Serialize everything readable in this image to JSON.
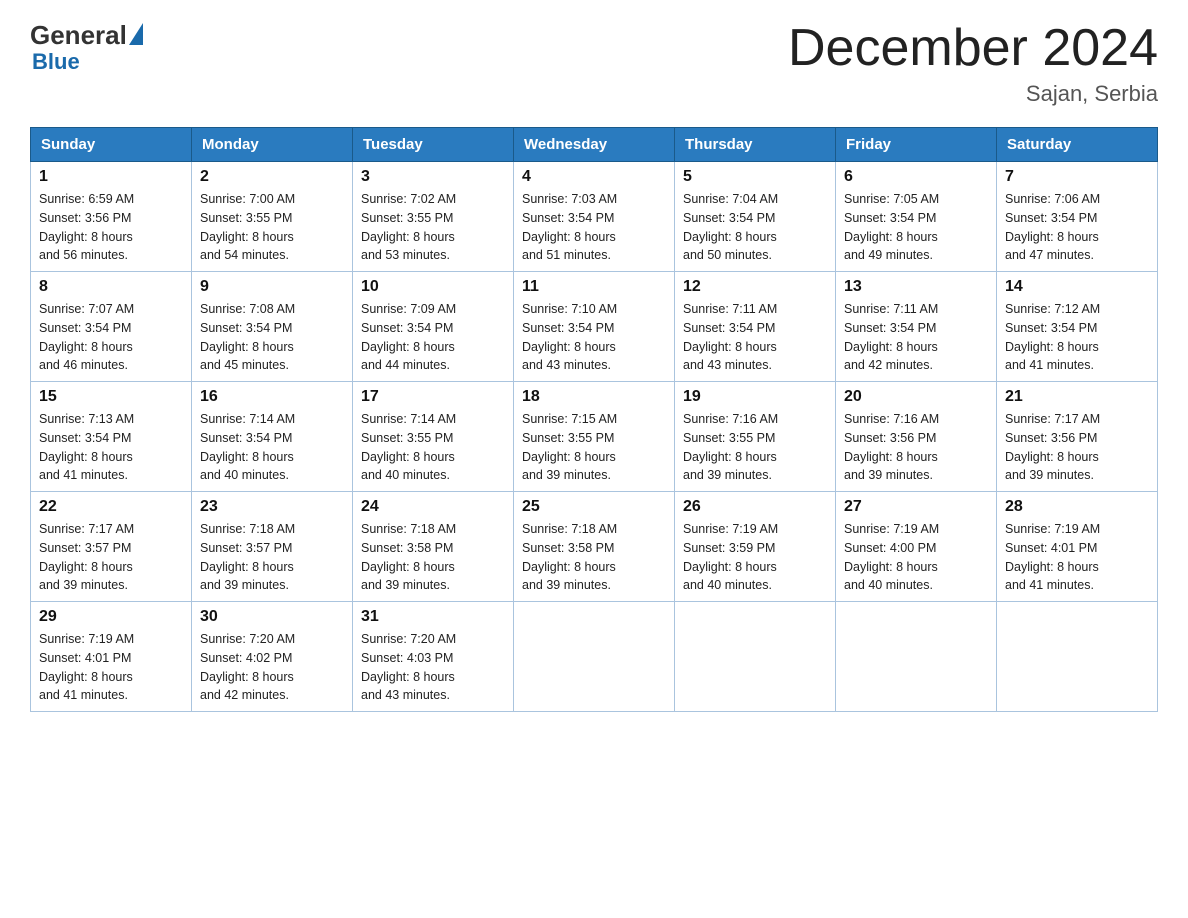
{
  "header": {
    "logo_general": "General",
    "logo_blue": "Blue",
    "month_title": "December 2024",
    "location": "Sajan, Serbia"
  },
  "days_of_week": [
    "Sunday",
    "Monday",
    "Tuesday",
    "Wednesday",
    "Thursday",
    "Friday",
    "Saturday"
  ],
  "weeks": [
    [
      {
        "day": "1",
        "sunrise": "6:59 AM",
        "sunset": "3:56 PM",
        "daylight": "8 hours and 56 minutes."
      },
      {
        "day": "2",
        "sunrise": "7:00 AM",
        "sunset": "3:55 PM",
        "daylight": "8 hours and 54 minutes."
      },
      {
        "day": "3",
        "sunrise": "7:02 AM",
        "sunset": "3:55 PM",
        "daylight": "8 hours and 53 minutes."
      },
      {
        "day": "4",
        "sunrise": "7:03 AM",
        "sunset": "3:54 PM",
        "daylight": "8 hours and 51 minutes."
      },
      {
        "day": "5",
        "sunrise": "7:04 AM",
        "sunset": "3:54 PM",
        "daylight": "8 hours and 50 minutes."
      },
      {
        "day": "6",
        "sunrise": "7:05 AM",
        "sunset": "3:54 PM",
        "daylight": "8 hours and 49 minutes."
      },
      {
        "day": "7",
        "sunrise": "7:06 AM",
        "sunset": "3:54 PM",
        "daylight": "8 hours and 47 minutes."
      }
    ],
    [
      {
        "day": "8",
        "sunrise": "7:07 AM",
        "sunset": "3:54 PM",
        "daylight": "8 hours and 46 minutes."
      },
      {
        "day": "9",
        "sunrise": "7:08 AM",
        "sunset": "3:54 PM",
        "daylight": "8 hours and 45 minutes."
      },
      {
        "day": "10",
        "sunrise": "7:09 AM",
        "sunset": "3:54 PM",
        "daylight": "8 hours and 44 minutes."
      },
      {
        "day": "11",
        "sunrise": "7:10 AM",
        "sunset": "3:54 PM",
        "daylight": "8 hours and 43 minutes."
      },
      {
        "day": "12",
        "sunrise": "7:11 AM",
        "sunset": "3:54 PM",
        "daylight": "8 hours and 43 minutes."
      },
      {
        "day": "13",
        "sunrise": "7:11 AM",
        "sunset": "3:54 PM",
        "daylight": "8 hours and 42 minutes."
      },
      {
        "day": "14",
        "sunrise": "7:12 AM",
        "sunset": "3:54 PM",
        "daylight": "8 hours and 41 minutes."
      }
    ],
    [
      {
        "day": "15",
        "sunrise": "7:13 AM",
        "sunset": "3:54 PM",
        "daylight": "8 hours and 41 minutes."
      },
      {
        "day": "16",
        "sunrise": "7:14 AM",
        "sunset": "3:54 PM",
        "daylight": "8 hours and 40 minutes."
      },
      {
        "day": "17",
        "sunrise": "7:14 AM",
        "sunset": "3:55 PM",
        "daylight": "8 hours and 40 minutes."
      },
      {
        "day": "18",
        "sunrise": "7:15 AM",
        "sunset": "3:55 PM",
        "daylight": "8 hours and 39 minutes."
      },
      {
        "day": "19",
        "sunrise": "7:16 AM",
        "sunset": "3:55 PM",
        "daylight": "8 hours and 39 minutes."
      },
      {
        "day": "20",
        "sunrise": "7:16 AM",
        "sunset": "3:56 PM",
        "daylight": "8 hours and 39 minutes."
      },
      {
        "day": "21",
        "sunrise": "7:17 AM",
        "sunset": "3:56 PM",
        "daylight": "8 hours and 39 minutes."
      }
    ],
    [
      {
        "day": "22",
        "sunrise": "7:17 AM",
        "sunset": "3:57 PM",
        "daylight": "8 hours and 39 minutes."
      },
      {
        "day": "23",
        "sunrise": "7:18 AM",
        "sunset": "3:57 PM",
        "daylight": "8 hours and 39 minutes."
      },
      {
        "day": "24",
        "sunrise": "7:18 AM",
        "sunset": "3:58 PM",
        "daylight": "8 hours and 39 minutes."
      },
      {
        "day": "25",
        "sunrise": "7:18 AM",
        "sunset": "3:58 PM",
        "daylight": "8 hours and 39 minutes."
      },
      {
        "day": "26",
        "sunrise": "7:19 AM",
        "sunset": "3:59 PM",
        "daylight": "8 hours and 40 minutes."
      },
      {
        "day": "27",
        "sunrise": "7:19 AM",
        "sunset": "4:00 PM",
        "daylight": "8 hours and 40 minutes."
      },
      {
        "day": "28",
        "sunrise": "7:19 AM",
        "sunset": "4:01 PM",
        "daylight": "8 hours and 41 minutes."
      }
    ],
    [
      {
        "day": "29",
        "sunrise": "7:19 AM",
        "sunset": "4:01 PM",
        "daylight": "8 hours and 41 minutes."
      },
      {
        "day": "30",
        "sunrise": "7:20 AM",
        "sunset": "4:02 PM",
        "daylight": "8 hours and 42 minutes."
      },
      {
        "day": "31",
        "sunrise": "7:20 AM",
        "sunset": "4:03 PM",
        "daylight": "8 hours and 43 minutes."
      },
      null,
      null,
      null,
      null
    ]
  ],
  "labels": {
    "sunrise": "Sunrise:",
    "sunset": "Sunset:",
    "daylight": "Daylight:"
  }
}
